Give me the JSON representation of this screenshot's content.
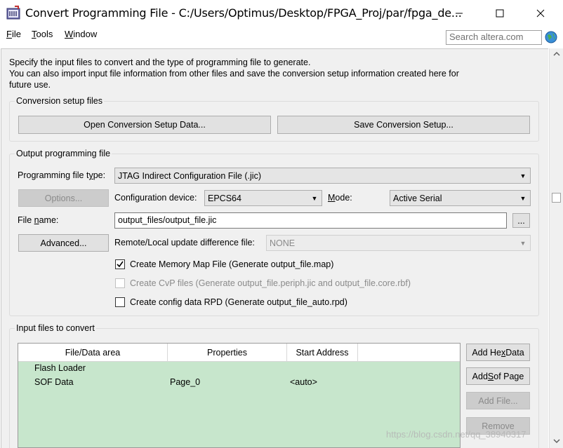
{
  "window": {
    "title": "Convert Programming File - C:/Users/Optimus/Desktop/FPGA_Proj/par/fpga_de...",
    "icon": "quartus-app-icon",
    "controls": [
      "minimize-icon",
      "maximize-icon",
      "close-icon"
    ]
  },
  "menu": {
    "items": [
      {
        "label": "File",
        "mnemonic": "F",
        "rest": "ile"
      },
      {
        "label": "Tools",
        "mnemonic": "T",
        "rest": "ools"
      },
      {
        "label": "Window",
        "mnemonic": "W",
        "rest": "indow"
      }
    ],
    "search_placeholder": "Search altera.com",
    "globe_icon": "globe-icon"
  },
  "intro": {
    "line1": "Specify the input files to convert and the type of programming file to generate.",
    "line2": "You can also import input file information from other files and save the conversion setup information created here for",
    "line3": "future use."
  },
  "conversion_setup": {
    "title": "Conversion setup files",
    "open_button": "Open Conversion Setup Data...",
    "save_button": "Save Conversion Setup..."
  },
  "output": {
    "title": "Output programming file",
    "file_type_label_pre": "Programming file t",
    "file_type_label_u": "y",
    "file_type_label_post": "pe:",
    "file_type_value": "JTAG Indirect Configuration File (.jic)",
    "options_button": "Options...",
    "config_device_label_pre": "Confi",
    "config_device_label_u": "g",
    "config_device_label_post": "uration device:",
    "config_device_value": "EPCS64",
    "mode_label_pre": "",
    "mode_label_u": "M",
    "mode_label_post": "ode:",
    "mode_value": "Active Serial",
    "file_name_label_pre": "File ",
    "file_name_label_u": "n",
    "file_name_label_post": "ame:",
    "file_name_value": "output_files/output_file.jic",
    "browse_button": "...",
    "advanced_button": "Advanced...",
    "remote_label": "Remote/Local update difference file:",
    "remote_value": "NONE",
    "chk_map_label": "Create Memory Map File (Generate output_file.map)",
    "chk_map_checked": true,
    "chk_cvp_label": "Create CvP files (Generate output_file.periph.jic and output_file.core.rbf)",
    "chk_cvp_checked": false,
    "chk_rpd_label": "Create config data RPD (Generate output_file_auto.rpd)",
    "chk_rpd_checked": false
  },
  "input_files": {
    "title": "Input files to convert",
    "columns": [
      "File/Data area",
      "Properties",
      "Start Address"
    ],
    "rows": [
      {
        "name": "Flash Loader",
        "properties": "",
        "start": ""
      },
      {
        "name": "SOF Data",
        "properties": "Page_0",
        "start": "<auto>"
      }
    ],
    "add_hex_pre": "Add He",
    "add_hex_u": "x",
    "add_hex_post": " Data",
    "add_sof_pre": "Add ",
    "add_sof_u": "S",
    "add_sof_post": "of Page",
    "add_file_button": "Add File...",
    "remove_button": "Remove"
  },
  "watermark": "https://blog.csdn.net/qq_38940317",
  "colors": {
    "dialog_bg": "#f0f0f0",
    "table_bg": "#c7e6cc",
    "disabled_text": "#8a8a8a"
  }
}
